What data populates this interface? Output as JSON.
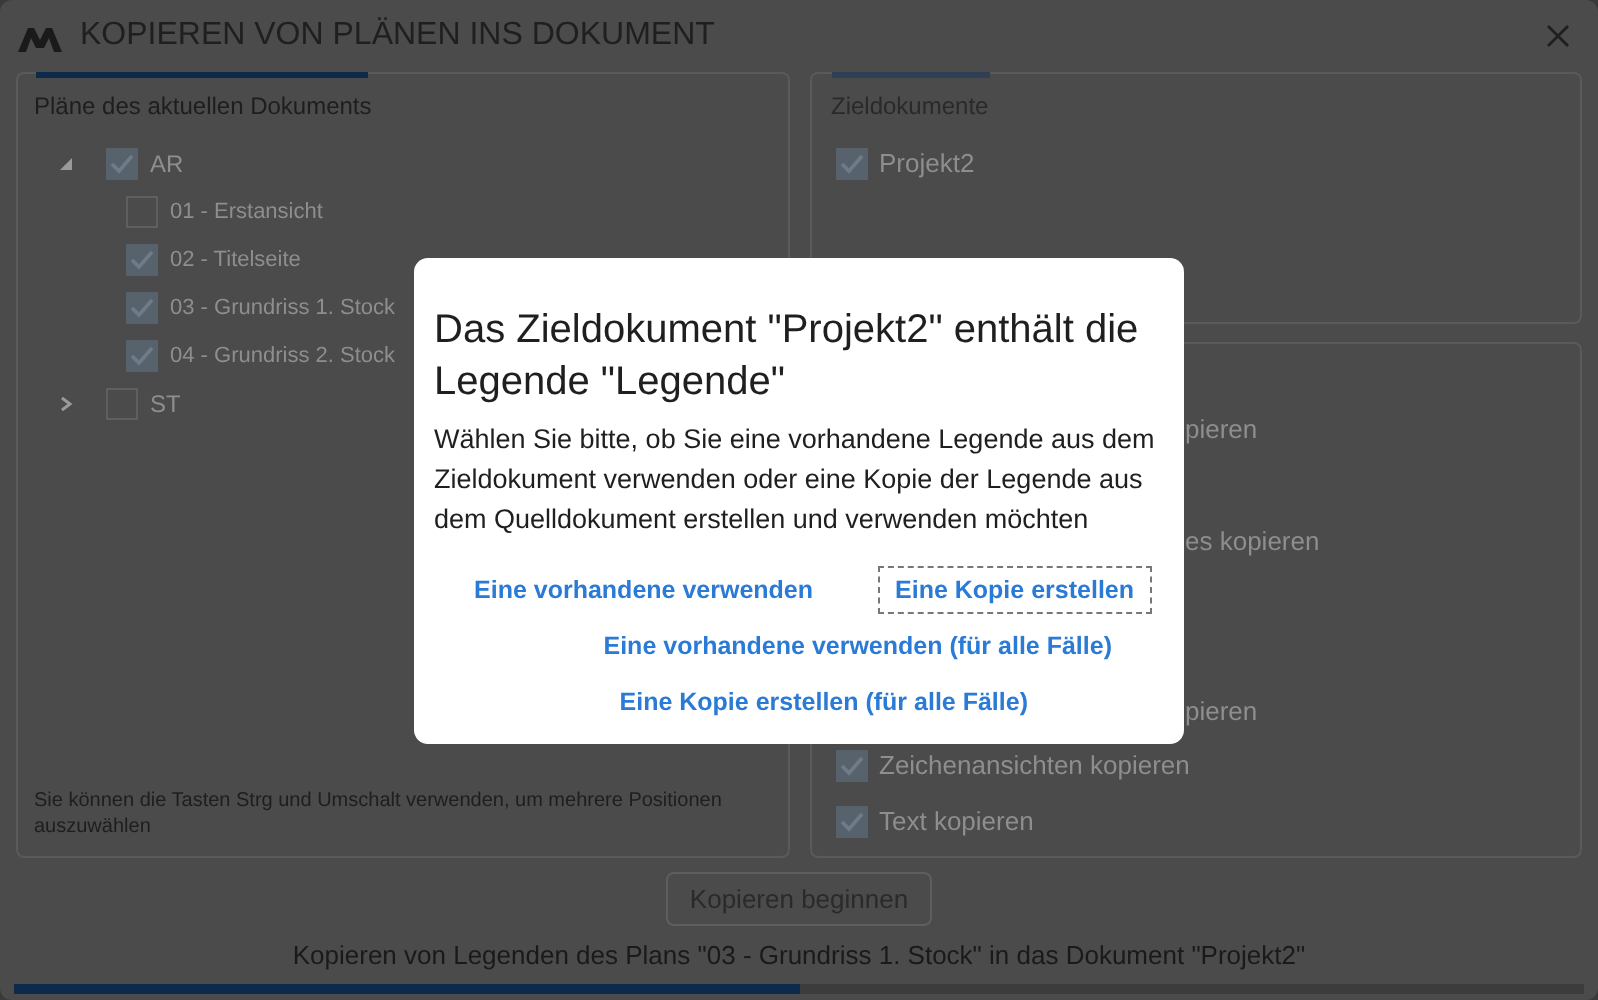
{
  "window": {
    "title": "KOPIEREN VON PLÄNEN INS DOKUMENT"
  },
  "source_panel": {
    "heading": "Pläne des aktuellen Dokuments",
    "tree": [
      {
        "label": "AR",
        "checked": true,
        "expanded": true,
        "children": [
          {
            "label": "01 - Erstansicht",
            "checked": false
          },
          {
            "label": "02 - Titelseite",
            "checked": true
          },
          {
            "label": "03 - Grundriss 1. Stock",
            "checked": true
          },
          {
            "label": "04 - Grundriss 2. Stock",
            "checked": true
          }
        ]
      },
      {
        "label": "ST",
        "checked": false,
        "expanded": false
      }
    ],
    "hint": "Sie können die Tasten Strg und Umschalt verwenden, um mehrere Positionen auszuwählen"
  },
  "target_panel": {
    "heading": "Zieldokumente",
    "documents": [
      {
        "label": "Projekt2",
        "checked": true
      }
    ]
  },
  "options_panel": {
    "options": [
      {
        "kind": "partial",
        "label": "pieren"
      },
      {
        "kind": "partial",
        "label": "es kopieren"
      },
      {
        "kind": "partial",
        "label": "pieren"
      },
      {
        "kind": "option",
        "label": "Zeichenansichten kopieren",
        "checked": true
      },
      {
        "kind": "option",
        "label": "Text kopieren",
        "checked": true
      }
    ]
  },
  "start_button": "Kopieren beginnen",
  "status": "Kopieren von Legenden des Plans \"03 - Grundriss 1. Stock\" in das Dokument \"Projekt2\"",
  "progress": {
    "level": 0.5
  },
  "dialog": {
    "title": "Das Zieldokument \"Projekt2\" enthält die Legende \"Legende\"",
    "message": "Wählen Sie bitte, ob Sie eine vorhandene Legende aus dem Zieldokument verwenden oder eine Kopie der Legende aus dem Quelldokument erstellen und verwenden möchten",
    "button_rows": [
      [
        {
          "label": "Eine vorhandene verwenden",
          "focused": false
        },
        {
          "label": "Eine Kopie erstellen",
          "focused": true
        }
      ],
      [
        {
          "label": "Eine vorhandene verwenden (für alle Fälle)",
          "focused": false
        }
      ],
      [
        {
          "label": "Eine Kopie erstellen (für alle Fälle)",
          "focused": false
        }
      ]
    ]
  }
}
